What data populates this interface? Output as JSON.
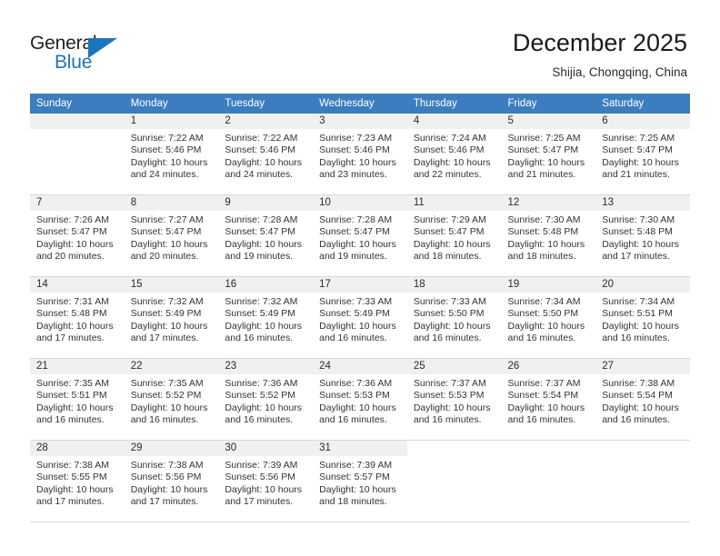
{
  "logo": {
    "word_top": "General",
    "word_bottom": "Blue",
    "flag_icon": "blue-triangle-flag-icon",
    "accent_color": "#1b75bc"
  },
  "header": {
    "title": "December 2025",
    "subtitle": "Shijia, Chongqing, China"
  },
  "colors": {
    "header_blue": "#3b7dbf",
    "daynum_gray": "#f0f0f0",
    "grid_line": "#d8d8d8",
    "text": "#333333"
  },
  "weekday_headers": [
    "Sunday",
    "Monday",
    "Tuesday",
    "Wednesday",
    "Thursday",
    "Friday",
    "Saturday"
  ],
  "weeks": [
    [
      {
        "day": "",
        "sunrise": "",
        "sunset": "",
        "daylight_l1": "",
        "daylight_l2": "",
        "empty": true
      },
      {
        "day": "1",
        "sunrise": "Sunrise: 7:22 AM",
        "sunset": "Sunset: 5:46 PM",
        "daylight_l1": "Daylight: 10 hours",
        "daylight_l2": "and 24 minutes."
      },
      {
        "day": "2",
        "sunrise": "Sunrise: 7:22 AM",
        "sunset": "Sunset: 5:46 PM",
        "daylight_l1": "Daylight: 10 hours",
        "daylight_l2": "and 24 minutes."
      },
      {
        "day": "3",
        "sunrise": "Sunrise: 7:23 AM",
        "sunset": "Sunset: 5:46 PM",
        "daylight_l1": "Daylight: 10 hours",
        "daylight_l2": "and 23 minutes."
      },
      {
        "day": "4",
        "sunrise": "Sunrise: 7:24 AM",
        "sunset": "Sunset: 5:46 PM",
        "daylight_l1": "Daylight: 10 hours",
        "daylight_l2": "and 22 minutes."
      },
      {
        "day": "5",
        "sunrise": "Sunrise: 7:25 AM",
        "sunset": "Sunset: 5:47 PM",
        "daylight_l1": "Daylight: 10 hours",
        "daylight_l2": "and 21 minutes."
      },
      {
        "day": "6",
        "sunrise": "Sunrise: 7:25 AM",
        "sunset": "Sunset: 5:47 PM",
        "daylight_l1": "Daylight: 10 hours",
        "daylight_l2": "and 21 minutes."
      }
    ],
    [
      {
        "day": "7",
        "sunrise": "Sunrise: 7:26 AM",
        "sunset": "Sunset: 5:47 PM",
        "daylight_l1": "Daylight: 10 hours",
        "daylight_l2": "and 20 minutes."
      },
      {
        "day": "8",
        "sunrise": "Sunrise: 7:27 AM",
        "sunset": "Sunset: 5:47 PM",
        "daylight_l1": "Daylight: 10 hours",
        "daylight_l2": "and 20 minutes."
      },
      {
        "day": "9",
        "sunrise": "Sunrise: 7:28 AM",
        "sunset": "Sunset: 5:47 PM",
        "daylight_l1": "Daylight: 10 hours",
        "daylight_l2": "and 19 minutes."
      },
      {
        "day": "10",
        "sunrise": "Sunrise: 7:28 AM",
        "sunset": "Sunset: 5:47 PM",
        "daylight_l1": "Daylight: 10 hours",
        "daylight_l2": "and 19 minutes."
      },
      {
        "day": "11",
        "sunrise": "Sunrise: 7:29 AM",
        "sunset": "Sunset: 5:47 PM",
        "daylight_l1": "Daylight: 10 hours",
        "daylight_l2": "and 18 minutes."
      },
      {
        "day": "12",
        "sunrise": "Sunrise: 7:30 AM",
        "sunset": "Sunset: 5:48 PM",
        "daylight_l1": "Daylight: 10 hours",
        "daylight_l2": "and 18 minutes."
      },
      {
        "day": "13",
        "sunrise": "Sunrise: 7:30 AM",
        "sunset": "Sunset: 5:48 PM",
        "daylight_l1": "Daylight: 10 hours",
        "daylight_l2": "and 17 minutes."
      }
    ],
    [
      {
        "day": "14",
        "sunrise": "Sunrise: 7:31 AM",
        "sunset": "Sunset: 5:48 PM",
        "daylight_l1": "Daylight: 10 hours",
        "daylight_l2": "and 17 minutes."
      },
      {
        "day": "15",
        "sunrise": "Sunrise: 7:32 AM",
        "sunset": "Sunset: 5:49 PM",
        "daylight_l1": "Daylight: 10 hours",
        "daylight_l2": "and 17 minutes."
      },
      {
        "day": "16",
        "sunrise": "Sunrise: 7:32 AM",
        "sunset": "Sunset: 5:49 PM",
        "daylight_l1": "Daylight: 10 hours",
        "daylight_l2": "and 16 minutes."
      },
      {
        "day": "17",
        "sunrise": "Sunrise: 7:33 AM",
        "sunset": "Sunset: 5:49 PM",
        "daylight_l1": "Daylight: 10 hours",
        "daylight_l2": "and 16 minutes."
      },
      {
        "day": "18",
        "sunrise": "Sunrise: 7:33 AM",
        "sunset": "Sunset: 5:50 PM",
        "daylight_l1": "Daylight: 10 hours",
        "daylight_l2": "and 16 minutes."
      },
      {
        "day": "19",
        "sunrise": "Sunrise: 7:34 AM",
        "sunset": "Sunset: 5:50 PM",
        "daylight_l1": "Daylight: 10 hours",
        "daylight_l2": "and 16 minutes."
      },
      {
        "day": "20",
        "sunrise": "Sunrise: 7:34 AM",
        "sunset": "Sunset: 5:51 PM",
        "daylight_l1": "Daylight: 10 hours",
        "daylight_l2": "and 16 minutes."
      }
    ],
    [
      {
        "day": "21",
        "sunrise": "Sunrise: 7:35 AM",
        "sunset": "Sunset: 5:51 PM",
        "daylight_l1": "Daylight: 10 hours",
        "daylight_l2": "and 16 minutes."
      },
      {
        "day": "22",
        "sunrise": "Sunrise: 7:35 AM",
        "sunset": "Sunset: 5:52 PM",
        "daylight_l1": "Daylight: 10 hours",
        "daylight_l2": "and 16 minutes."
      },
      {
        "day": "23",
        "sunrise": "Sunrise: 7:36 AM",
        "sunset": "Sunset: 5:52 PM",
        "daylight_l1": "Daylight: 10 hours",
        "daylight_l2": "and 16 minutes."
      },
      {
        "day": "24",
        "sunrise": "Sunrise: 7:36 AM",
        "sunset": "Sunset: 5:53 PM",
        "daylight_l1": "Daylight: 10 hours",
        "daylight_l2": "and 16 minutes."
      },
      {
        "day": "25",
        "sunrise": "Sunrise: 7:37 AM",
        "sunset": "Sunset: 5:53 PM",
        "daylight_l1": "Daylight: 10 hours",
        "daylight_l2": "and 16 minutes."
      },
      {
        "day": "26",
        "sunrise": "Sunrise: 7:37 AM",
        "sunset": "Sunset: 5:54 PM",
        "daylight_l1": "Daylight: 10 hours",
        "daylight_l2": "and 16 minutes."
      },
      {
        "day": "27",
        "sunrise": "Sunrise: 7:38 AM",
        "sunset": "Sunset: 5:54 PM",
        "daylight_l1": "Daylight: 10 hours",
        "daylight_l2": "and 16 minutes."
      }
    ],
    [
      {
        "day": "28",
        "sunrise": "Sunrise: 7:38 AM",
        "sunset": "Sunset: 5:55 PM",
        "daylight_l1": "Daylight: 10 hours",
        "daylight_l2": "and 17 minutes."
      },
      {
        "day": "29",
        "sunrise": "Sunrise: 7:38 AM",
        "sunset": "Sunset: 5:56 PM",
        "daylight_l1": "Daylight: 10 hours",
        "daylight_l2": "and 17 minutes."
      },
      {
        "day": "30",
        "sunrise": "Sunrise: 7:39 AM",
        "sunset": "Sunset: 5:56 PM",
        "daylight_l1": "Daylight: 10 hours",
        "daylight_l2": "and 17 minutes."
      },
      {
        "day": "31",
        "sunrise": "Sunrise: 7:39 AM",
        "sunset": "Sunset: 5:57 PM",
        "daylight_l1": "Daylight: 10 hours",
        "daylight_l2": "and 18 minutes."
      },
      {
        "day": "",
        "sunrise": "",
        "sunset": "",
        "daylight_l1": "",
        "daylight_l2": "",
        "blank": true
      },
      {
        "day": "",
        "sunrise": "",
        "sunset": "",
        "daylight_l1": "",
        "daylight_l2": "",
        "blank": true
      },
      {
        "day": "",
        "sunrise": "",
        "sunset": "",
        "daylight_l1": "",
        "daylight_l2": "",
        "blank": true
      }
    ]
  ]
}
